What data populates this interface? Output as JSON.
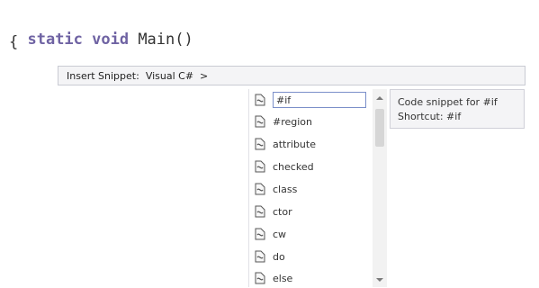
{
  "code": {
    "line1_kw": "static void",
    "line1_rest": " Main()",
    "line2": "{"
  },
  "snippet_bar": {
    "label": "Insert Snippet:",
    "crumb": "Visual C#",
    "sep": ">"
  },
  "snippets": [
    {
      "name": "#if",
      "selected": true
    },
    {
      "name": "#region"
    },
    {
      "name": "attribute"
    },
    {
      "name": "checked"
    },
    {
      "name": "class"
    },
    {
      "name": "ctor"
    },
    {
      "name": "cw"
    },
    {
      "name": "do"
    },
    {
      "name": "else"
    }
  ],
  "tooltip": {
    "line1": "Code snippet for #if",
    "line2": "Shortcut: #if"
  },
  "icons": {
    "snippet": "snippet-icon"
  },
  "colors": {
    "keyword": "#6f63a3",
    "selection_border": "#7b8fc9"
  }
}
